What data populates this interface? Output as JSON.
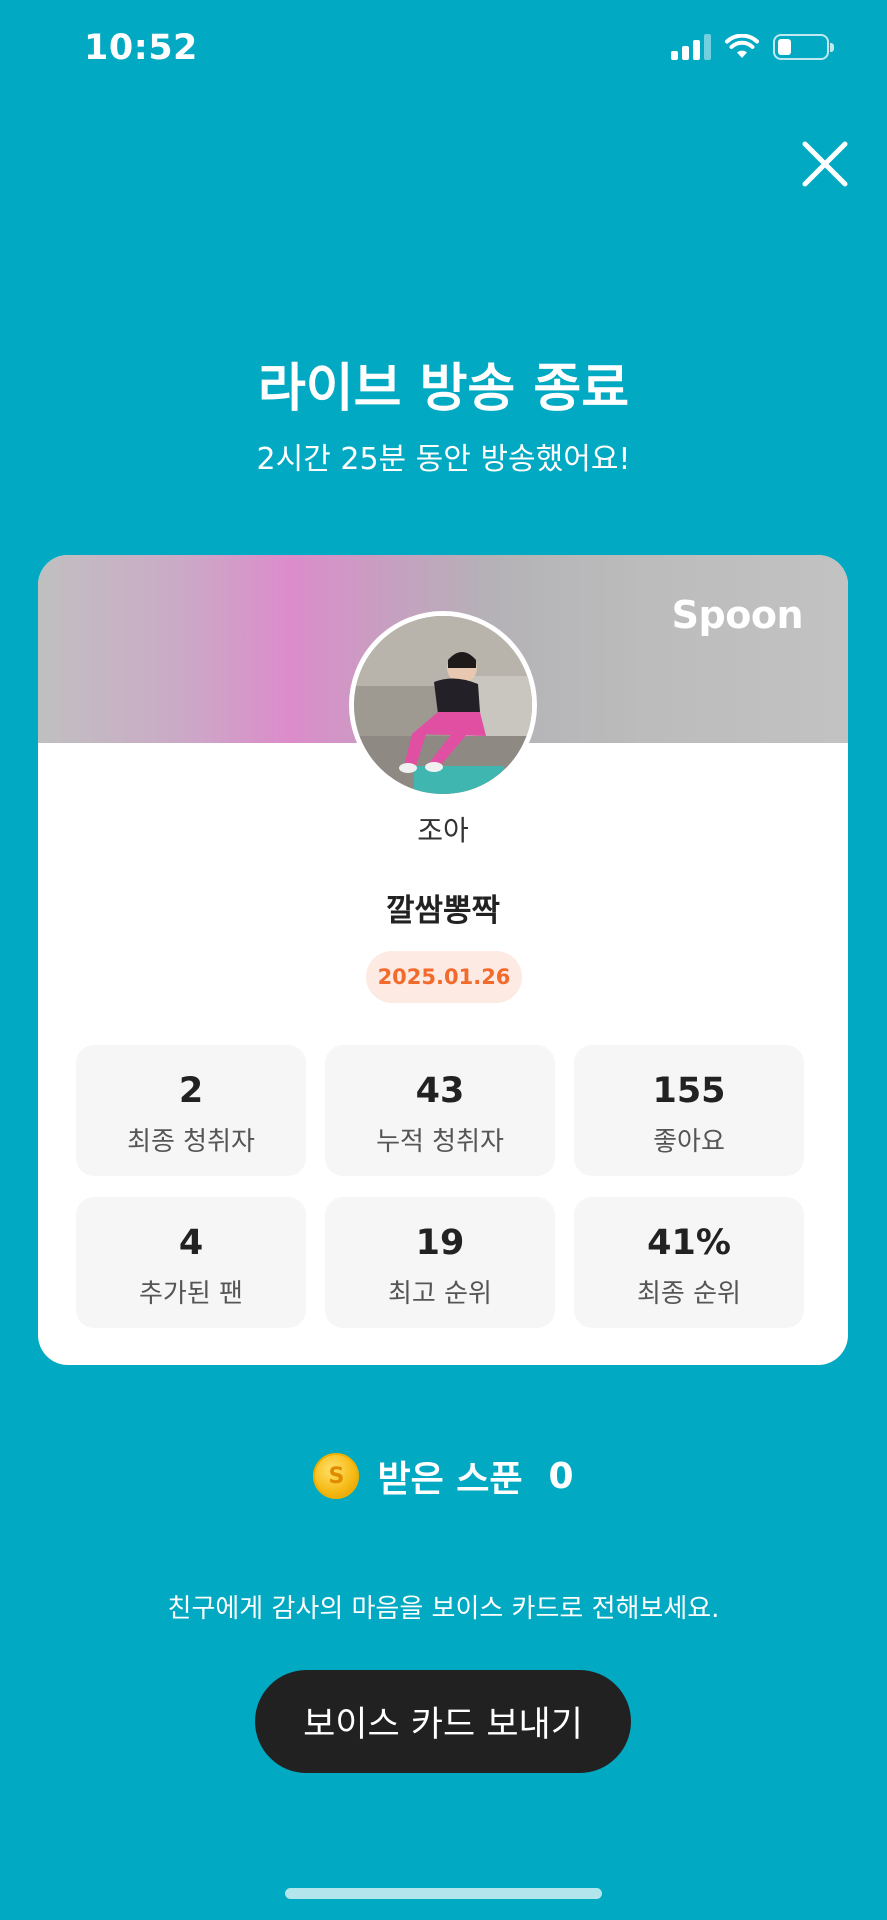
{
  "status_bar": {
    "time": "10:52"
  },
  "header": {
    "title": "라이브 방송 종료",
    "subtitle": "2시간 25분 동안 방송했어요!"
  },
  "card": {
    "brand": "Spoon",
    "nickname": "조아",
    "show_title": "깔쌈뽕짝",
    "date": "2025.01.26",
    "stats": [
      {
        "value": "2",
        "label": "최종 청취자"
      },
      {
        "value": "43",
        "label": "누적 청취자"
      },
      {
        "value": "155",
        "label": "좋아요"
      },
      {
        "value": "4",
        "label": "추가된 팬"
      },
      {
        "value": "19",
        "label": "최고 순위"
      },
      {
        "value": "41%",
        "label": "최종 순위"
      }
    ]
  },
  "spoon": {
    "icon_letter": "S",
    "label": "받은 스푼",
    "count": "0"
  },
  "footer": {
    "message": "친구에게 감사의 마음을 보이스 카드로 전해보세요.",
    "button_label": "보이스 카드 보내기"
  },
  "colors": {
    "background": "#01A9C3",
    "accent": "#F26A2C",
    "button": "#212121"
  }
}
